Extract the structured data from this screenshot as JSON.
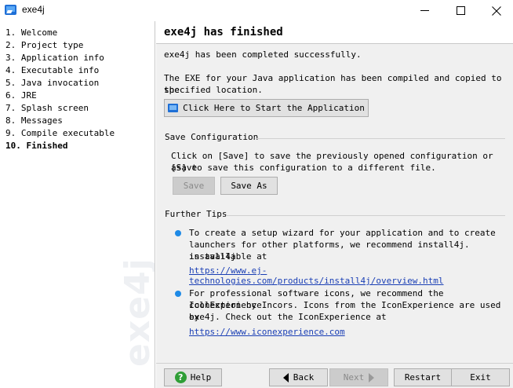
{
  "window": {
    "title": "exe4j"
  },
  "sidebar": {
    "steps": [
      {
        "label": "1. Welcome"
      },
      {
        "label": "2. Project type"
      },
      {
        "label": "3. Application info"
      },
      {
        "label": "4. Executable info"
      },
      {
        "label": "5. Java invocation"
      },
      {
        "label": "6. JRE"
      },
      {
        "label": "7. Splash screen"
      },
      {
        "label": "8. Messages"
      },
      {
        "label": "9. Compile executable"
      },
      {
        "label": "10. Finished"
      }
    ],
    "current_step": 10,
    "watermark": "exe4j"
  },
  "main": {
    "title": "exe4j has finished",
    "completed_text": "exe4j has been completed successfully.",
    "compiled_text_line1": "The EXE for your Java application has been compiled and copied to the",
    "compiled_text_line2": "specified location.",
    "launch_button": "Click Here to Start the Application",
    "save_config": {
      "title": "Save Configuration",
      "text_line1": "Click on [Save] to save the previously opened configuration or [Save",
      "text_line2": "as] to save this configuration to a different file.",
      "save_button": "Save",
      "save_as_button": "Save As"
    },
    "tips": {
      "title": "Further Tips",
      "tip1_line1": "To create a setup wizard for your application and to create",
      "tip1_line2": "launchers for other platforms, we recommend install4j. install4j",
      "tip1_line3": "is available at",
      "tip1_link": "https://www.ej-technologies.com/products/install4j/overview.html",
      "tip2_line1": "For professional software icons, we recommend the IconExperience",
      "tip2_line2": "collection by Incors. Icons from the IconExperience are used by",
      "tip2_line3": "exe4j. Check out the IconExperience at",
      "tip2_link": "https://www.iconexperience.com"
    }
  },
  "footer": {
    "help_button": "Help",
    "back_button": "Back",
    "next_button": "Next",
    "restart_button": "Restart",
    "exit_button": "Exit"
  },
  "colors": {
    "accent": "#1e8ae6",
    "link": "#1a3fb5",
    "help_icon": "#2f9e36"
  }
}
